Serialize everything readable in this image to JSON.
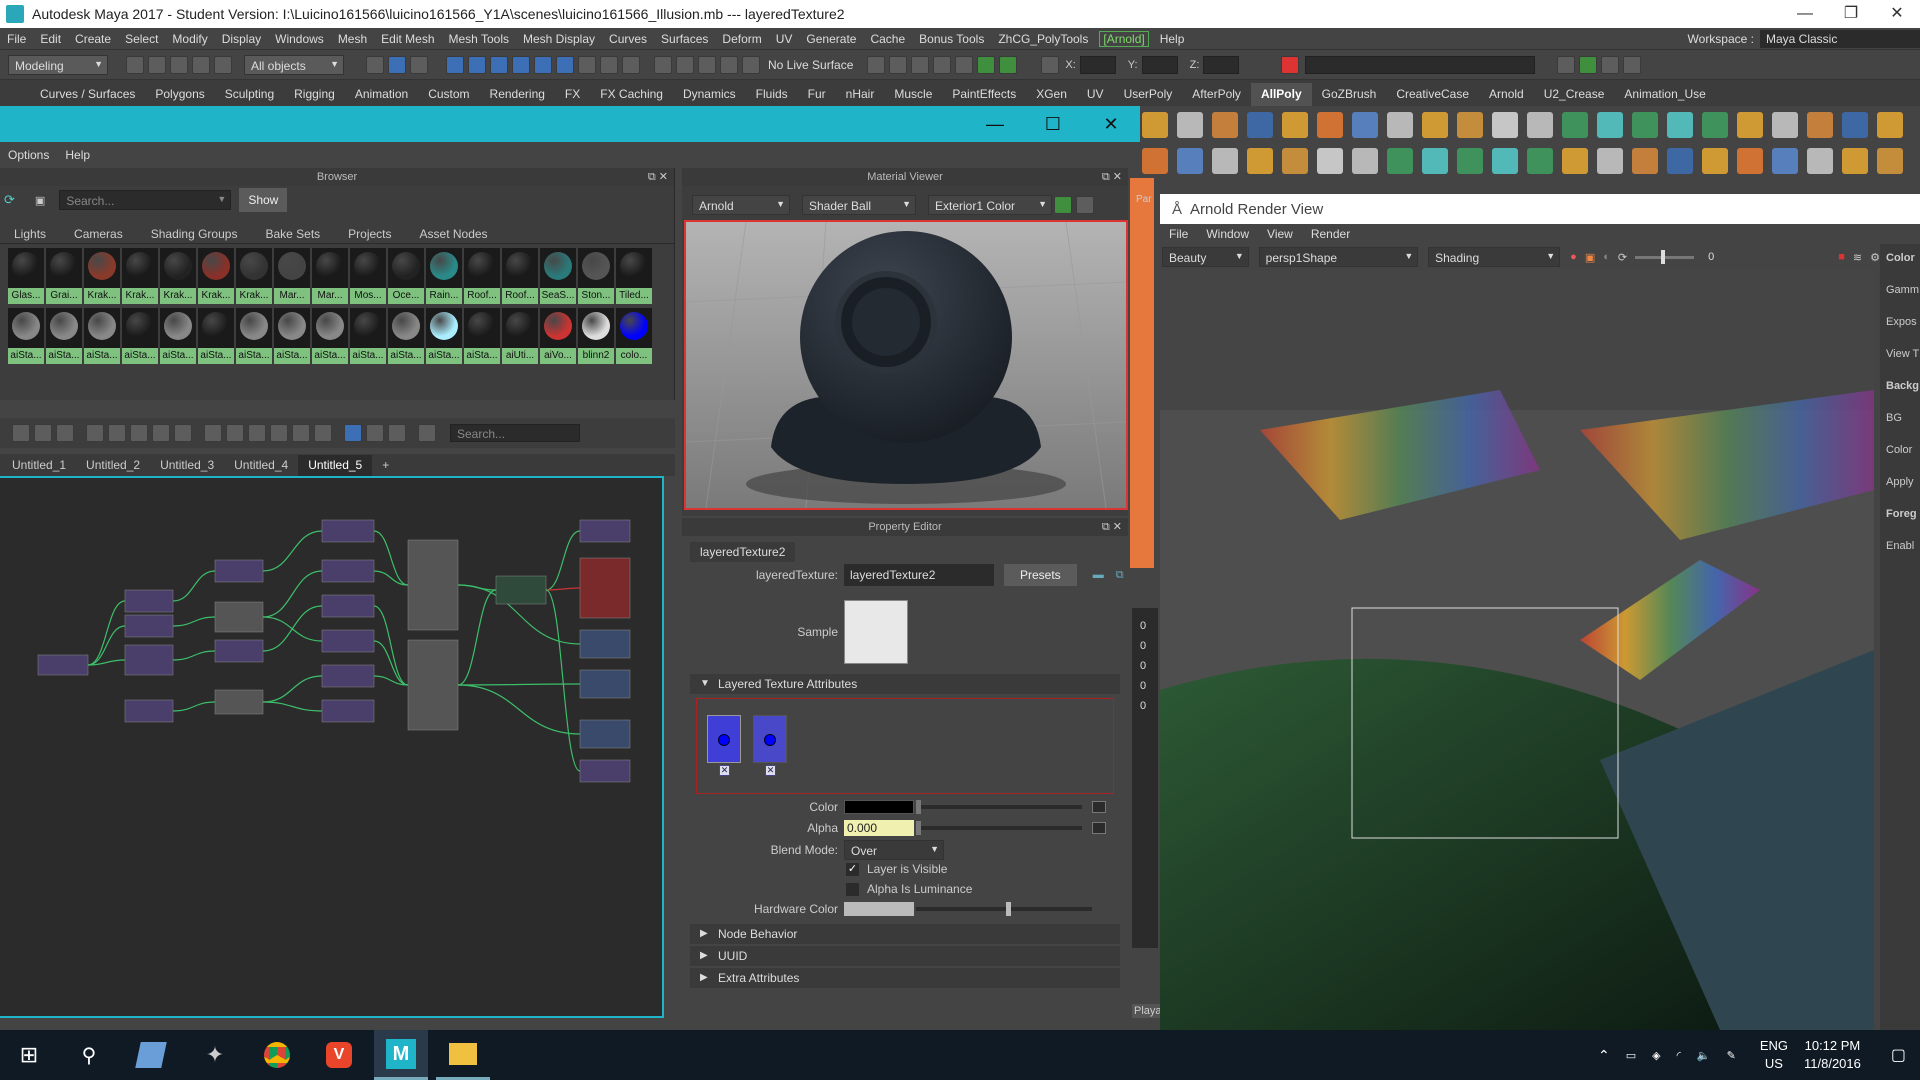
{
  "window": {
    "title": "Autodesk Maya 2017 - Student Version: I:\\Luicino161566\\luicino161566_Y1A\\scenes\\luicino161566_Illusion.mb   ---   layeredTexture2"
  },
  "menubar": {
    "items": [
      "File",
      "Edit",
      "Create",
      "Select",
      "Modify",
      "Display",
      "Windows",
      "Mesh",
      "Edit Mesh",
      "Mesh Tools",
      "Mesh Display",
      "Curves",
      "Surfaces",
      "Deform",
      "UV",
      "Generate",
      "Cache",
      "Bonus Tools",
      "ZhCG_PolyTools"
    ],
    "arnold": "[Arnold]",
    "help": "Help"
  },
  "workspace": {
    "label": "Workspace :",
    "value": "Maya Classic"
  },
  "statusline": {
    "mode": "Modeling",
    "selection": "All objects",
    "live_surface": "No Live Surface",
    "x": "X:",
    "y": "Y:",
    "z": "Z:"
  },
  "shelf": {
    "tabs": [
      "Curves / Surfaces",
      "Polygons",
      "Sculpting",
      "Rigging",
      "Animation",
      "Custom",
      "Rendering",
      "FX",
      "FX Caching",
      "Dynamics",
      "Fluids",
      "Fur",
      "nHair",
      "Muscle",
      "PaintEffects",
      "XGen",
      "UV",
      "UserPoly",
      "AfterPoly",
      "AllPoly",
      "GoZBrush",
      "CreativeCase",
      "Arnold",
      "U2_Crease",
      "Animation_Use"
    ],
    "active": "AllPoly"
  },
  "hypershade": {
    "menu": [
      "Options",
      "Help"
    ],
    "browser": {
      "title": "Browser",
      "search_placeholder": "Search...",
      "show": "Show",
      "tabs": [
        "Lights",
        "Cameras",
        "Shading Groups",
        "Bake Sets",
        "Projects",
        "Asset Nodes"
      ],
      "row1": [
        "Glas...",
        "Grai...",
        "Krak...",
        "Krak...",
        "Krak...",
        "Krak...",
        "Krak...",
        "Mar...",
        "Mar...",
        "Mos...",
        "Oce...",
        "Rain...",
        "Roof...",
        "Roof...",
        "SeaS...",
        "Ston...",
        "Tiled..."
      ],
      "row2": [
        "aiSta...",
        "aiSta...",
        "aiSta...",
        "aiSta...",
        "aiSta...",
        "aiSta...",
        "aiSta...",
        "aiSta...",
        "aiSta...",
        "aiSta...",
        "aiSta...",
        "aiSta...",
        "aiSta...",
        "aiUti...",
        "aiVo...",
        "blinn2",
        "colo..."
      ]
    },
    "node_editor": {
      "search_placeholder": "Search...",
      "tabs": [
        "Untitled_1",
        "Untitled_2",
        "Untitled_3",
        "Untitled_4",
        "Untitled_5",
        "+"
      ],
      "active_tab": "Untitled_5"
    },
    "material_viewer": {
      "title": "Material Viewer",
      "renderer": "Arnold",
      "geometry": "Shader Ball",
      "env": "Exterior1 Color"
    },
    "property_editor": {
      "title": "Property Editor",
      "tab": "layeredTexture2",
      "node_label": "layeredTexture:",
      "node_value": "layeredTexture2",
      "presets": "Presets",
      "sample_label": "Sample",
      "section_layered": "Layered Texture Attributes",
      "color_label": "Color",
      "alpha_label": "Alpha",
      "alpha_value": "0.000",
      "blend_label": "Blend Mode:",
      "blend_value": "Over",
      "layer_visible": "Layer is Visible",
      "alpha_lum": "Alpha Is Luminance",
      "hw_color": "Hardware Color",
      "sections": [
        "Node Behavior",
        "UUID",
        "Extra Attributes"
      ]
    }
  },
  "render_view": {
    "title": "Arnold Render View",
    "menu": [
      "File",
      "Window",
      "View",
      "Render"
    ],
    "aov": "Beauty",
    "camera": "persp1Shape",
    "mode": "Shading",
    "slider_value": "0",
    "side": [
      "Color",
      "Gamm",
      "Expos",
      "View T",
      "Backg",
      "BG",
      "Color",
      "Apply",
      "Foreg",
      "Enabl"
    ]
  },
  "side_strip": {
    "numbers": [
      "0",
      "0",
      "0",
      "0",
      "0"
    ],
    "par": "Par",
    "playa": "Playa"
  },
  "taskbar": {
    "lang1": "ENG",
    "lang2": "US",
    "time": "10:12 PM",
    "date": "11/8/2016"
  }
}
